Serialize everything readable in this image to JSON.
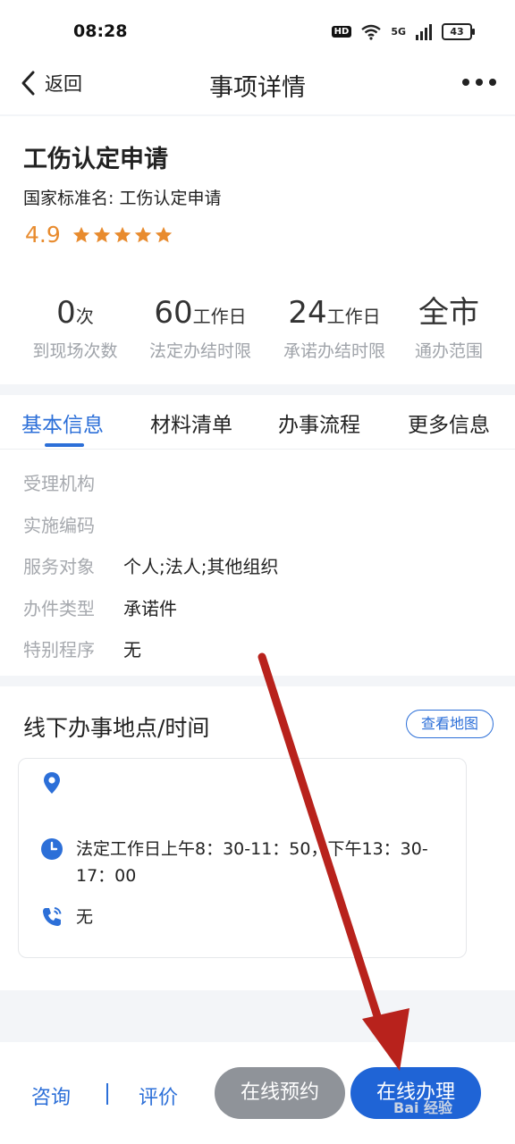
{
  "status_bar": {
    "time": "08:28",
    "hd": "HD",
    "network": "5G",
    "battery": "43"
  },
  "nav": {
    "back_label": "返回",
    "title": "事项详情"
  },
  "item": {
    "title": "工伤认定申请",
    "standard_name": "国家标准名: 工伤认定申请",
    "rating": "4.9",
    "stars": 5
  },
  "stats": [
    {
      "value": "0",
      "unit": "次",
      "label": "到现场次数"
    },
    {
      "value": "60",
      "unit": "工作日",
      "label": "法定办结时限"
    },
    {
      "value": "24",
      "unit": "工作日",
      "label": "承诺办结时限"
    },
    {
      "value": "全市",
      "unit": "",
      "label": "通办范围"
    }
  ],
  "tabs": [
    {
      "label": "基本信息",
      "active": true
    },
    {
      "label": "材料清单",
      "active": false
    },
    {
      "label": "办事流程",
      "active": false
    },
    {
      "label": "更多信息",
      "active": false
    }
  ],
  "basic_info": [
    {
      "label": "受理机构",
      "value": ""
    },
    {
      "label": "实施编码",
      "value": ""
    },
    {
      "label": "服务对象",
      "value": "个人;法人;其他组织"
    },
    {
      "label": "办件类型",
      "value": "承诺件"
    },
    {
      "label": "特别程序",
      "value": "无"
    }
  ],
  "offline": {
    "title": "线下办事地点/时间",
    "map_button": "查看地图",
    "address": "",
    "hours": "法定工作日上午8：30-11：50，下午13：30-17：00",
    "phone": "无"
  },
  "bottom_bar": {
    "consult": "咨询",
    "rate": "评价",
    "appointment": "在线预约",
    "online_apply": "在线办理"
  },
  "watermark": "Bai 经验",
  "colors": {
    "accent": "#2c6fd8",
    "rating": "#e88b2e",
    "annotation_arrow": "#b8221c"
  }
}
